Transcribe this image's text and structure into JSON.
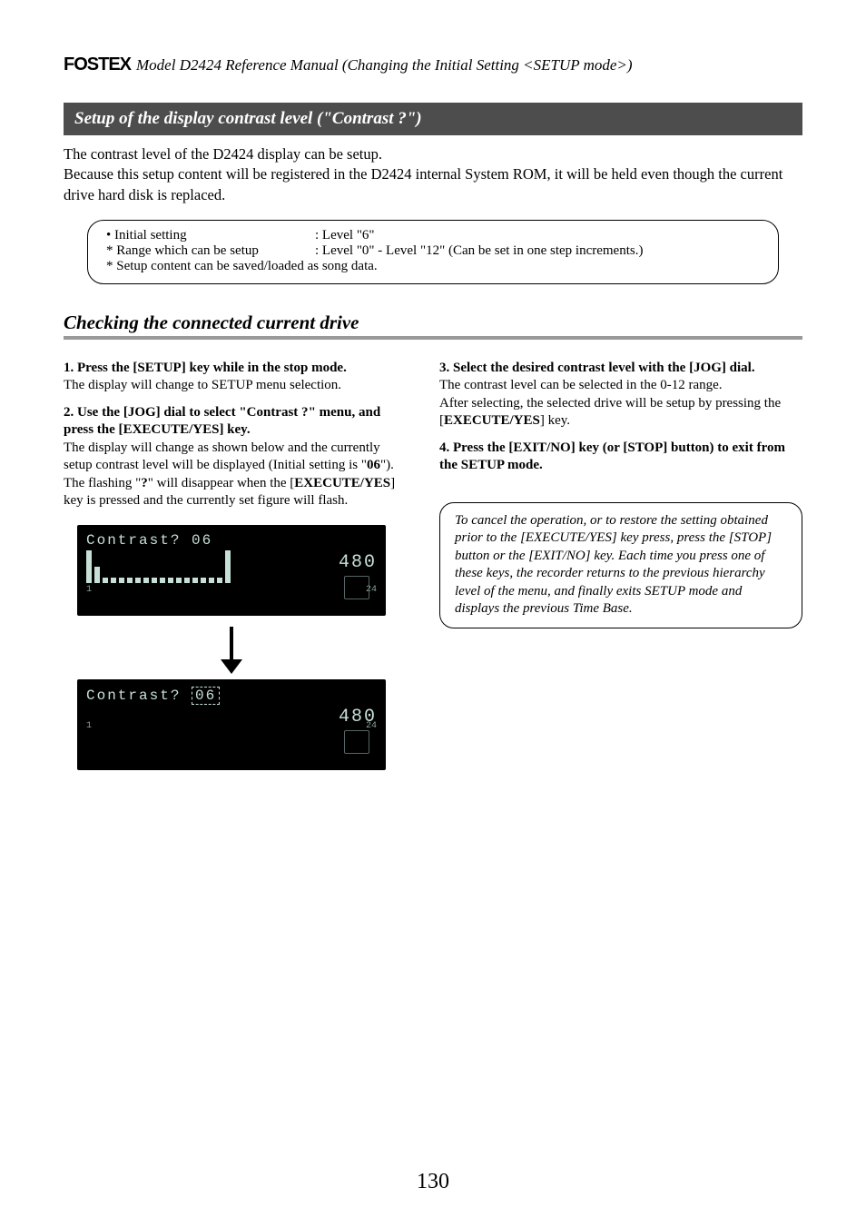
{
  "header": {
    "brand": "FOSTEX",
    "title": "Model D2424  Reference Manual (Changing the Initial Setting <SETUP mode>)"
  },
  "bar_title": "Setup of the display contrast level (\"Contrast ?\")",
  "intro_1": "The contrast level of the D2424 display can be setup.",
  "intro_2": "Because this setup content will be registered in the D2424 internal System ROM, it will be held even though the current drive hard disk is replaced.",
  "info_box": {
    "row1_label": "• Initial setting",
    "row1_value": ": Level \"6\"",
    "row2_label": "* Range which can be setup",
    "row2_value": ": Level \"0\" - Level \"12\" (Can be set in one step increments.)",
    "row3": "* Setup content can be saved/loaded as song data."
  },
  "heading": "Checking the connected current drive",
  "step1_line1_pre": "1. Press the [",
  "step1_line1_b": "SETUP",
  "step1_line1_post": "] key while in the stop mode.",
  "step1_line2": "The display will change to SETUP menu selection.",
  "step2_pre": "2. Use the [",
  "step2_b": "JOG",
  "step2_mid": "] dial to select \"",
  "step2_sel": "Contrast ?",
  "step2_mid2": "\" menu, and press the [",
  "step2_b2": "EXECUTE/YES",
  "step2_post": "] key.",
  "step2_body_a": "The display will change as shown below and the currently setup contrast level will be displayed (Initial setting is \"",
  "step2_body_val": "06",
  "step2_body_b": "\").",
  "step2_body_c_pre": "The flashing \"",
  "step2_body_c_q": "?",
  "step2_body_c_mid": "\" will disappear when the [",
  "step2_body_c_b": "EXECUTE/YES",
  "step2_body_c_post": "] key is pressed and the currently set figure will flash.",
  "lcd1_text": "Contrast? 06",
  "lcd_side_number": "480",
  "lcd2_text_pre": "Contrast?",
  "lcd2_text_val": "06",
  "step3_pre": "3. Select the desired contrast level with the [",
  "step3_b": "JOG",
  "step3_post": "] dial.",
  "step3_body_a": "The contrast level can be selected in the 0-12 range.",
  "step3_body_b_pre": "After selecting, the selected drive will be setup by pressing the [",
  "step3_body_b_b": "EXECUTE/YES",
  "step3_body_b_post": "] key.",
  "step4_pre": "4. Press the [",
  "step4_b1": "EXIT/NO",
  "step4_mid": "] key (or [",
  "step4_b2": "STOP",
  "step4_post": "] button) to exit from the SETUP mode.",
  "note_box": "To cancel the operation, or to restore the setting obtained prior to the [EXECUTE/YES] key press, press the [STOP] button or the [EXIT/NO] key.  Each time you press one of these keys, the recorder returns to the previous hierarchy level of the menu, and finally exits SETUP mode and displays the previous Time Base.",
  "page_number": "130"
}
